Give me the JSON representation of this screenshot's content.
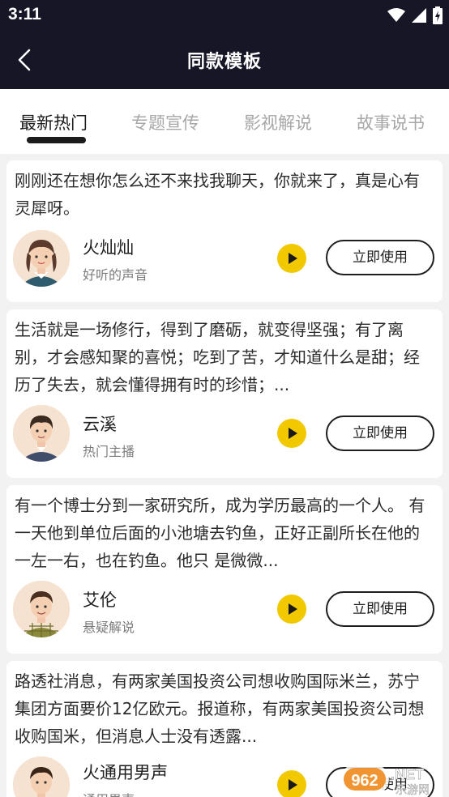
{
  "status_bar": {
    "time": "3:11"
  },
  "header": {
    "title": "同款模板"
  },
  "tabs": [
    {
      "label": "最新热门",
      "active": true
    },
    {
      "label": "专题宣传",
      "active": false
    },
    {
      "label": "影视解说",
      "active": false
    },
    {
      "label": "故事说书",
      "active": false
    }
  ],
  "cards": [
    {
      "text": "刚刚还在想你怎么还不来找我聊天，你就来了，真是心有灵犀呀。",
      "name": "火灿灿",
      "subtitle": "好听的声音",
      "button": "立即使用"
    },
    {
      "text": "生活就是一场修行，得到了磨砺，就变得坚强；有了离别，才会感知聚的喜悦；吃到了苦，才知道什么是甜；经历了失去，就会懂得拥有时的珍惜；...",
      "name": "云溪",
      "subtitle": "热门主播",
      "button": "立即使用"
    },
    {
      "text": "有一个博士分到一家研究所，成为学历最高的一个人。 有一天他到单位后面的小池塘去钓鱼，正好正副所长在他的一左一右，也在钓鱼。他只 是微微...",
      "name": "艾伦",
      "subtitle": "悬疑解说",
      "button": "立即使用"
    },
    {
      "text": "路透社消息，有两家美国投资公司想收购国际米兰，苏宁集团方面要价12亿欧元。报道称，有两家美国投资公司想收购国米，但消息人士没有透露...",
      "name": "火通用男声",
      "subtitle": "通用男声",
      "button": "立即使用"
    }
  ],
  "watermark": {
    "text_main": "962.NET",
    "text_sub": "乐游网"
  },
  "colors": {
    "header_bg": "#161626",
    "accent_play": "#f2c900",
    "page_bg": "#f2f2f2"
  }
}
